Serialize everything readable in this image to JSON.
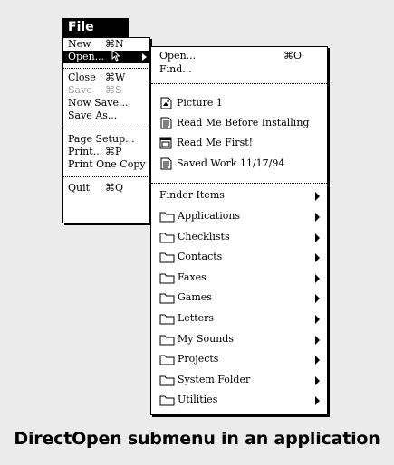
{
  "menu_title": "File",
  "file_menu": {
    "items": [
      {
        "label": "New",
        "key": "⌘N",
        "state": "normal"
      },
      {
        "label": "Open...",
        "key": "",
        "state": "highlighted"
      },
      {
        "label": "Close",
        "key": "⌘W",
        "state": "normal"
      },
      {
        "label": "Save",
        "key": "⌘S",
        "state": "disabled"
      },
      {
        "label": "Now Save...",
        "key": "",
        "state": "normal"
      },
      {
        "label": "Save As...",
        "key": "",
        "state": "normal"
      },
      {
        "label": "Page Setup...",
        "key": "",
        "state": "normal"
      },
      {
        "label": "Print...",
        "key": "⌘P",
        "state": "normal"
      },
      {
        "label": "Print One Copy",
        "key": "",
        "state": "normal"
      },
      {
        "label": "Quit",
        "key": "⌘Q",
        "state": "normal"
      }
    ]
  },
  "submenu": {
    "commands": [
      {
        "label": "Open...",
        "key": "⌘O"
      },
      {
        "label": "Find...",
        "key": ""
      }
    ],
    "recent": [
      {
        "label": "Picture 1",
        "icon": "picture-doc-icon"
      },
      {
        "label": "Read Me Before Installing",
        "icon": "text-doc-icon"
      },
      {
        "label": "Read Me First!",
        "icon": "readme-doc-icon"
      },
      {
        "label": "Saved Work 11/17/94",
        "icon": "text-doc-icon"
      }
    ],
    "finder_items": {
      "label": "Finder Items"
    },
    "folders": [
      {
        "label": "Applications"
      },
      {
        "label": "Checklists"
      },
      {
        "label": "Contacts"
      },
      {
        "label": "Faxes"
      },
      {
        "label": "Games"
      },
      {
        "label": "Letters"
      },
      {
        "label": "My Sounds"
      },
      {
        "label": "Projects"
      },
      {
        "label": "System Folder"
      },
      {
        "label": "Utilities"
      }
    ]
  },
  "caption": "DirectOpen submenu in an application"
}
